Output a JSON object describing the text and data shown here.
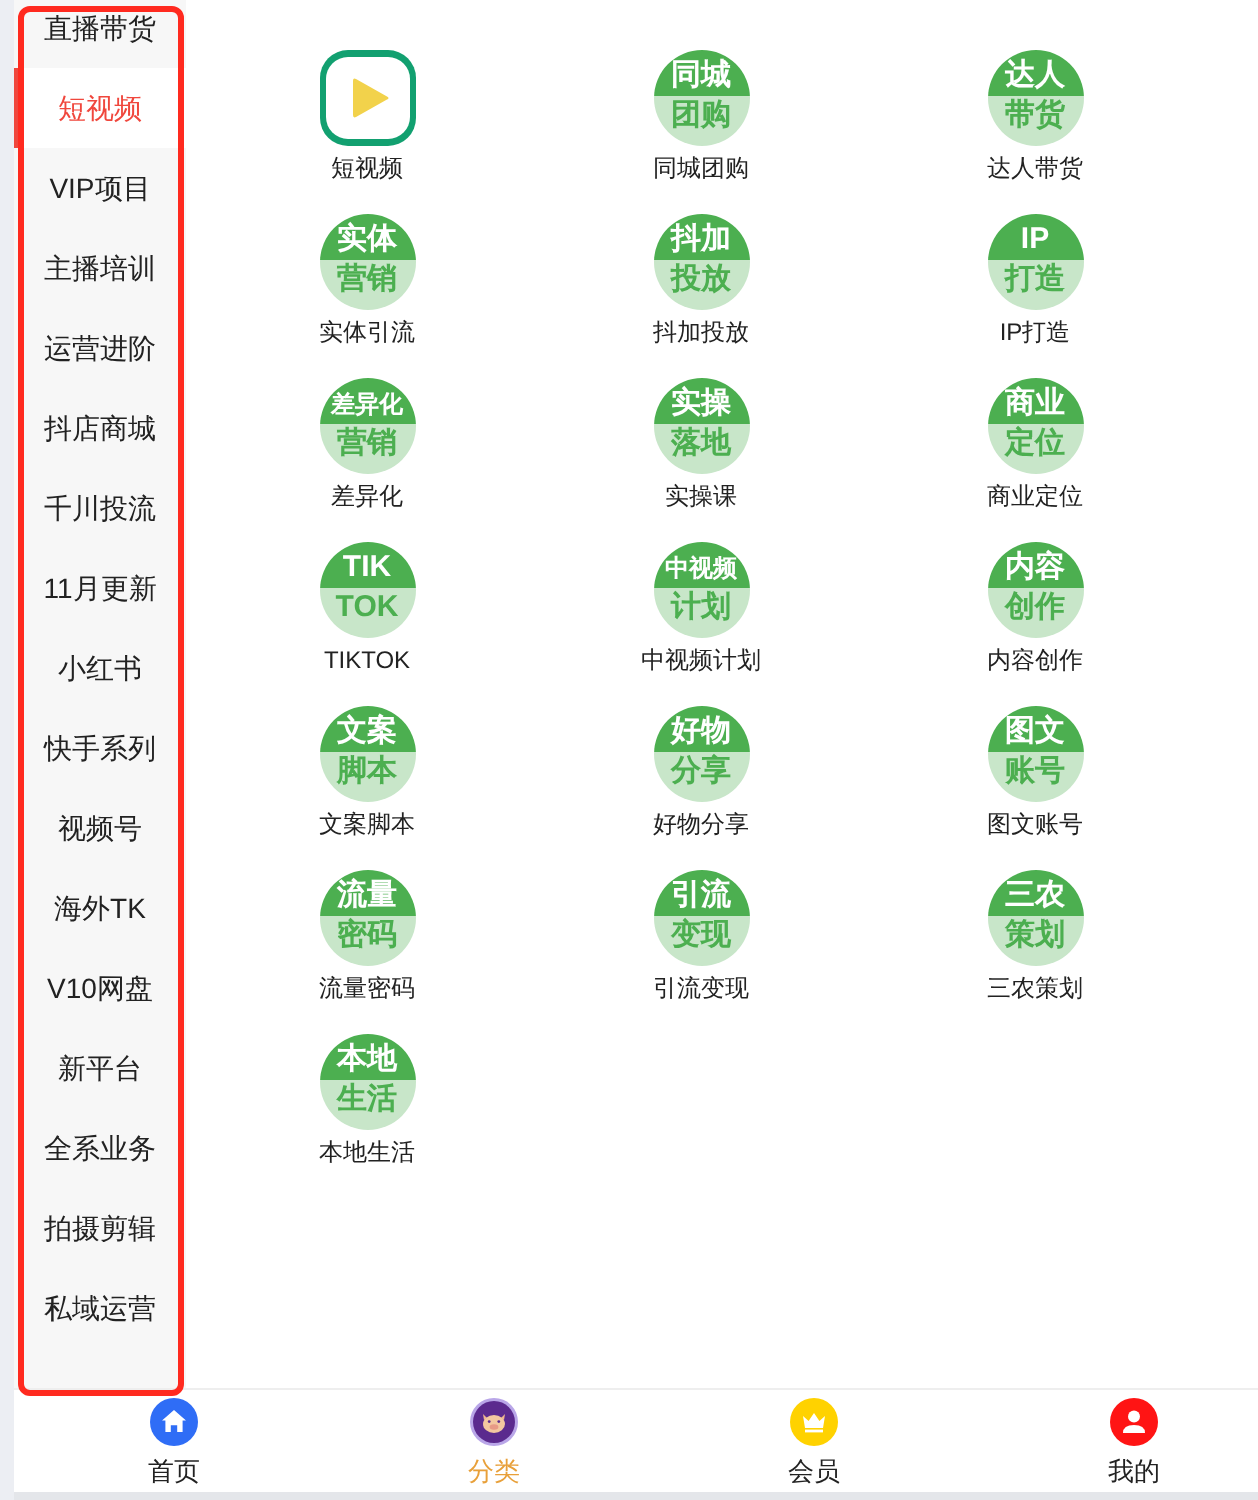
{
  "sidebar": {
    "items": [
      {
        "label": "直播带货",
        "selected": false
      },
      {
        "label": "短视频",
        "selected": true
      },
      {
        "label": "VIP项目",
        "selected": false
      },
      {
        "label": "主播培训",
        "selected": false
      },
      {
        "label": "运营进阶",
        "selected": false
      },
      {
        "label": "抖店商城",
        "selected": false
      },
      {
        "label": "千川投流",
        "selected": false
      },
      {
        "label": "11月更新",
        "selected": false
      },
      {
        "label": "小红书",
        "selected": false
      },
      {
        "label": "快手系列",
        "selected": false
      },
      {
        "label": "视频号",
        "selected": false
      },
      {
        "label": "海外TK",
        "selected": false
      },
      {
        "label": "V10网盘",
        "selected": false
      },
      {
        "label": "新平台",
        "selected": false
      },
      {
        "label": "全系业务",
        "selected": false
      },
      {
        "label": "拍摄剪辑",
        "selected": false
      },
      {
        "label": "私域运营",
        "selected": false
      }
    ]
  },
  "categories": {
    "rows": [
      {
        "tiles": [
          {
            "kind": "play",
            "label": "短视频"
          },
          {
            "kind": "emblem",
            "label": "同城团购",
            "emblem": {
              "top": "同城",
              "bottom": "团购"
            }
          },
          {
            "kind": "emblem",
            "label": "达人带货",
            "emblem": {
              "top": "达人",
              "bottom": "带货"
            }
          }
        ]
      },
      {
        "tiles": [
          {
            "kind": "emblem",
            "label": "实体引流",
            "emblem": {
              "top": "实体",
              "bottom": "营销"
            }
          },
          {
            "kind": "emblem",
            "label": "抖加投放",
            "emblem": {
              "top": "抖加",
              "bottom": "投放"
            }
          },
          {
            "kind": "emblem",
            "label": "IP打造",
            "emblem": {
              "top": "IP",
              "bottom": "打造"
            }
          }
        ]
      },
      {
        "tiles": [
          {
            "kind": "emblem",
            "label": "差异化",
            "emblem": {
              "top": "差异化",
              "bottom": "营销"
            }
          },
          {
            "kind": "emblem",
            "label": "实操课",
            "emblem": {
              "top": "实操",
              "bottom": "落地"
            }
          },
          {
            "kind": "emblem",
            "label": "商业定位",
            "emblem": {
              "top": "商业",
              "bottom": "定位"
            }
          }
        ]
      },
      {
        "tiles": [
          {
            "kind": "emblem",
            "label": "TIKTOK",
            "emblem": {
              "top": "TIK",
              "bottom": "TOK"
            }
          },
          {
            "kind": "emblem",
            "label": "中视频计划",
            "emblem": {
              "top": "中视频",
              "bottom": "计划"
            }
          },
          {
            "kind": "emblem",
            "label": "内容创作",
            "emblem": {
              "top": "内容",
              "bottom": "创作"
            }
          }
        ]
      },
      {
        "tiles": [
          {
            "kind": "emblem",
            "label": "文案脚本",
            "emblem": {
              "top": "文案",
              "bottom": "脚本"
            }
          },
          {
            "kind": "emblem",
            "label": "好物分享",
            "emblem": {
              "top": "好物",
              "bottom": "分享"
            }
          },
          {
            "kind": "emblem",
            "label": "图文账号",
            "emblem": {
              "top": "图文",
              "bottom": "账号"
            }
          }
        ]
      },
      {
        "tiles": [
          {
            "kind": "emblem",
            "label": "流量密码",
            "emblem": {
              "top": "流量",
              "bottom": "密码"
            }
          },
          {
            "kind": "emblem",
            "label": "引流变现",
            "emblem": {
              "top": "引流",
              "bottom": "变现"
            }
          },
          {
            "kind": "emblem",
            "label": "三农策划",
            "emblem": {
              "top": "三农",
              "bottom": "策划"
            }
          }
        ]
      },
      {
        "tiles": [
          {
            "kind": "emblem",
            "label": "本地生活",
            "emblem": {
              "top": "本地",
              "bottom": "生活"
            }
          }
        ]
      }
    ]
  },
  "nav": {
    "items": [
      {
        "label": "首页",
        "selected": false
      },
      {
        "label": "分类",
        "selected": true
      },
      {
        "label": "会员",
        "selected": false
      },
      {
        "label": "我的",
        "selected": false
      }
    ]
  }
}
